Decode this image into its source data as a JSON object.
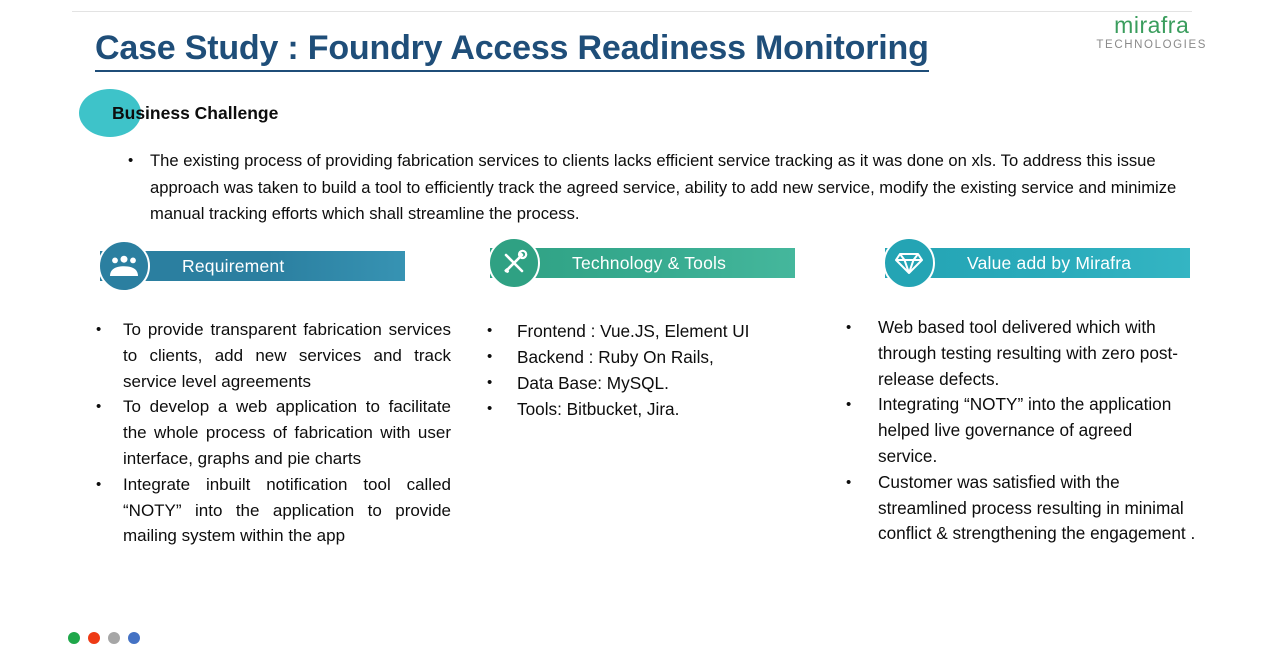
{
  "logo": {
    "name": "mirafra",
    "tagline": "TECHNOLOGIES",
    "name_color": "#3a9d5d",
    "tagline_color": "#8a8a8a"
  },
  "title": {
    "text": "Case Study : Foundry Access Readiness Monitoring",
    "color": "#1f4e79"
  },
  "business_challenge": {
    "heading": "Business Challenge",
    "circle_color": "#3ec3c9",
    "bullet_glyph": "•",
    "body": "The existing process of providing fabrication services to clients lacks efficient service tracking as it was done on xls. To address this issue approach was taken to build a tool to efficiently track the agreed service,  ability to add new service, modify the existing service and minimize manual tracking efforts which shall streamline the process."
  },
  "columns": [
    {
      "id": "requirement",
      "banner_label": "Requirement",
      "banner_color": "#2b7fa0",
      "icon_name": "people-group-icon",
      "bullet_glyph": "•",
      "items": [
        "To provide transparent fabrication services to clients, add new services and track service level agreements",
        "To develop a web application to facilitate the whole process of fabrication with user interface, graphs and pie charts",
        "Integrate inbuilt notification tool called “NOTY” into the application to provide mailing system within the app"
      ]
    },
    {
      "id": "technology-tools",
      "banner_label": "Technology & Tools",
      "banner_color": "#2fa183",
      "icon_name": "wrench-screwdriver-icon",
      "bullet_glyph": "•",
      "items": [
        "Frontend : Vue.JS, Element UI",
        "Backend : Ruby On Rails,",
        "Data Base: MySQL.",
        "Tools:  Bitbucket, Jira."
      ]
    },
    {
      "id": "value-add-by-mirafra",
      "banner_label": "Value add by Mirafra",
      "banner_color": "#24a4b4",
      "icon_name": "diamond-icon",
      "bullet_glyph": "•",
      "items": [
        "Web based tool delivered which with through testing resulting with zero post-release defects.",
        "Integrating  “NOTY” into the application helped live governance of agreed service.",
        "Customer was satisfied with the streamlined process resulting in minimal conflict & strengthening the engagement ."
      ]
    }
  ],
  "footer_dots": [
    {
      "name": "dot-green",
      "color": "#1fa74a"
    },
    {
      "name": "dot-red",
      "color": "#ee3a15"
    },
    {
      "name": "dot-gray",
      "color": "#a6a6a6"
    },
    {
      "name": "dot-blue",
      "color": "#4472c4"
    }
  ]
}
